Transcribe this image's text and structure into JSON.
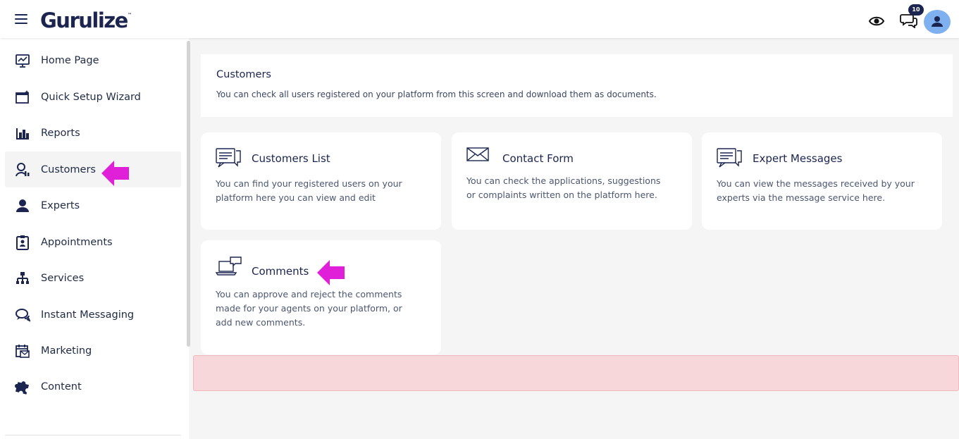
{
  "header": {
    "logo": "Gurulize",
    "logo_mark": "™",
    "message_count": "10"
  },
  "sidebar": {
    "items": [
      {
        "label": "Home Page",
        "icon": "monitor-chart-icon"
      },
      {
        "label": "Quick Setup Wizard",
        "icon": "wizard-window-icon"
      },
      {
        "label": "Reports",
        "icon": "bar-chart-icon"
      },
      {
        "label": "Customers",
        "icon": "customers-icon",
        "active": true
      },
      {
        "label": "Experts",
        "icon": "person-icon"
      },
      {
        "label": "Appointments",
        "icon": "clipboard-user-icon"
      },
      {
        "label": "Services",
        "icon": "sitemap-icon"
      },
      {
        "label": "Instant Messaging",
        "icon": "chat-icon"
      },
      {
        "label": "Marketing",
        "icon": "calendar-mail-icon"
      },
      {
        "label": "Content",
        "icon": "puzzle-icon"
      }
    ]
  },
  "page": {
    "title": "Customers",
    "description": "You can check all users registered on your platform from this screen and download them as documents."
  },
  "cards": [
    {
      "title": "Customers List",
      "description": [
        "You can find your registered users on your",
        "platform here you can view and edit"
      ],
      "icon": "list-chat-icon"
    },
    {
      "title": "Contact Form",
      "description": [
        "You can check the applications, suggestions",
        "or complaints written on the platform here."
      ],
      "icon": "envelope-icon"
    },
    {
      "title": "Expert Messages",
      "description": [
        "You can view the messages received by your",
        "experts via the message service here."
      ],
      "icon": "list-chat-icon"
    },
    {
      "title": "Comments",
      "description": [
        "You can approve and reject the comments",
        "made for your agents on your platform, or",
        "add new comments."
      ],
      "icon": "laptop-comment-icon"
    }
  ],
  "colors": {
    "brand": "#1b2550",
    "arrow": "#e020d8",
    "avatar": "#7fb0ef",
    "alert_bg": "#f8d7da"
  }
}
